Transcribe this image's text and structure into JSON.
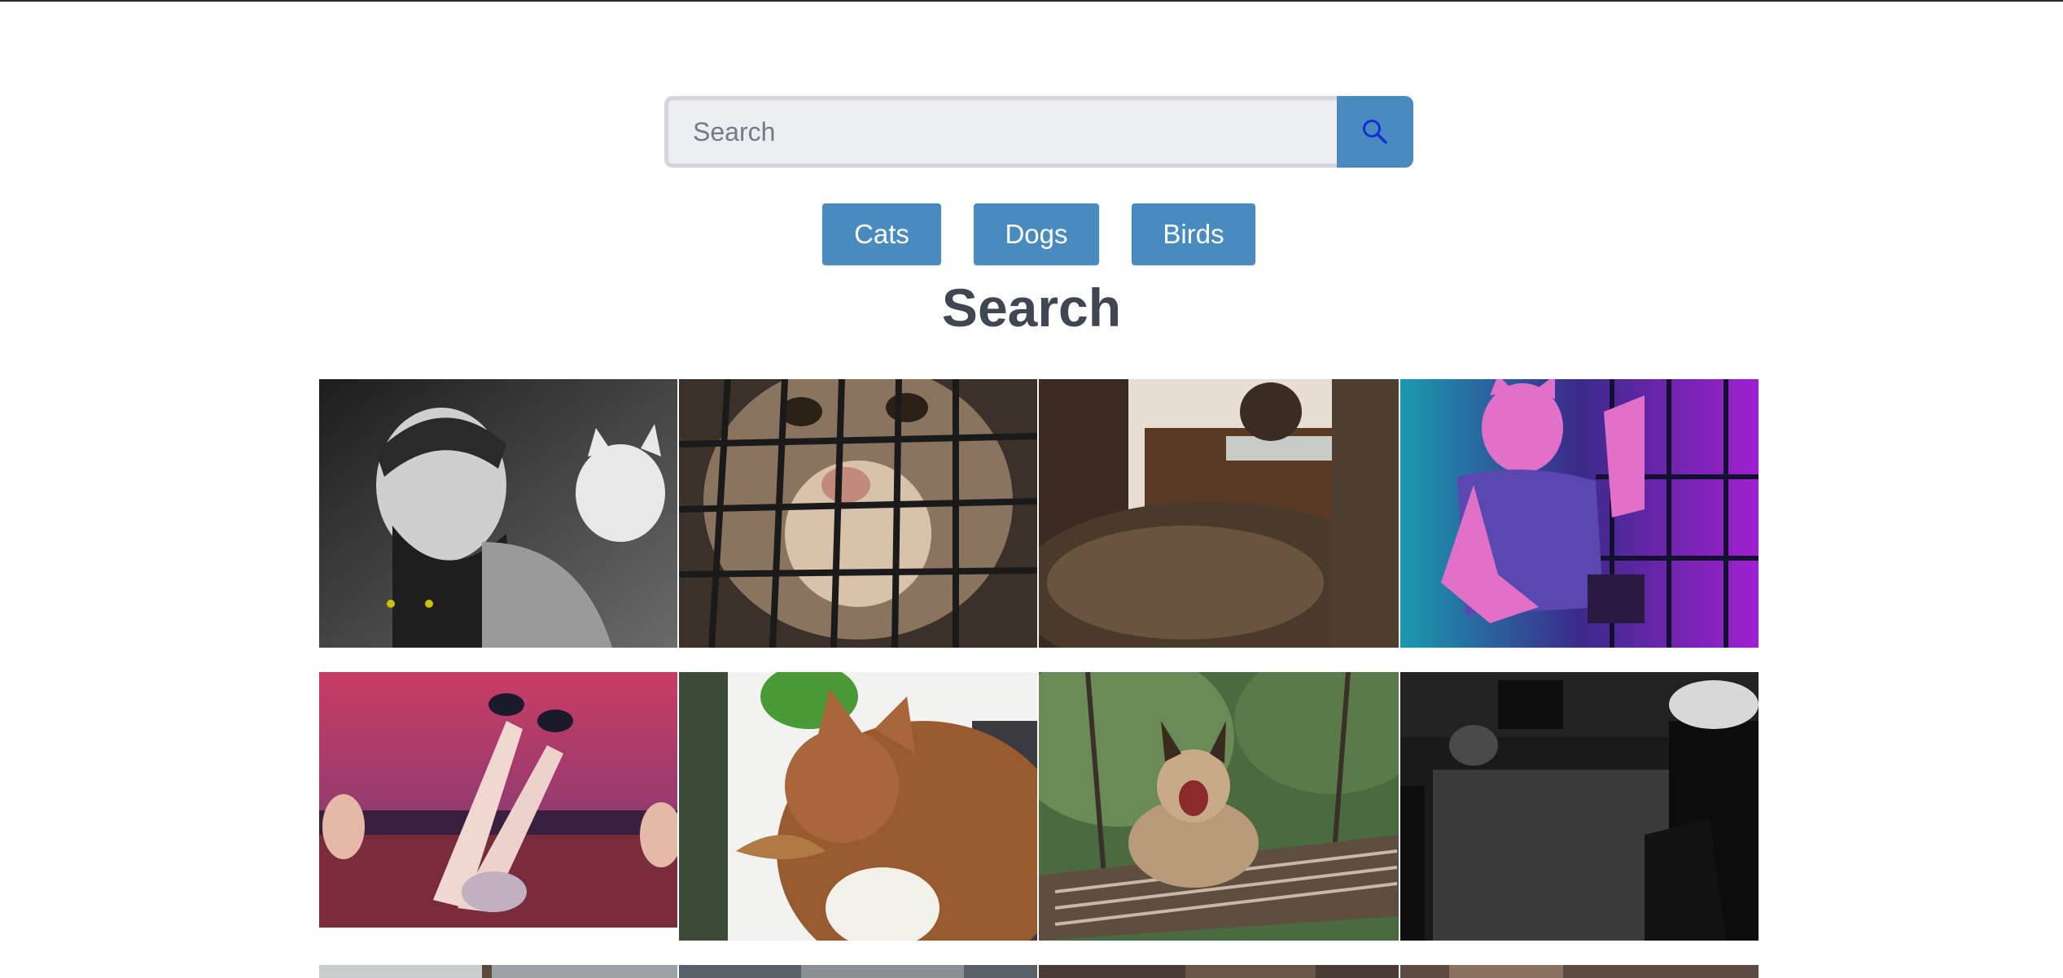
{
  "search": {
    "placeholder": "Search",
    "value": ""
  },
  "categories": [
    {
      "label": "Cats"
    },
    {
      "label": "Dogs"
    },
    {
      "label": "Birds"
    }
  ],
  "page_title": "Search",
  "colors": {
    "accent": "#4a8bbf",
    "search_icon": "#1a2bd8",
    "heading": "#3e4752",
    "input_bg": "#eceef1"
  },
  "gallery": {
    "items": [
      {
        "icon": "photo-man-with-cats"
      },
      {
        "icon": "photo-cat-in-carrier"
      },
      {
        "icon": "photo-fluffy-cat-on-chair"
      },
      {
        "icon": "photo-purple-tiger-character"
      },
      {
        "icon": "photo-pink-neon-art"
      },
      {
        "icon": "photo-orange-cat-window"
      },
      {
        "icon": "photo-lynx-yawning"
      },
      {
        "icon": "photo-dark-interior"
      },
      {
        "icon": "photo-partial-row"
      },
      {
        "icon": "photo-partial-row"
      },
      {
        "icon": "photo-partial-row"
      },
      {
        "icon": "photo-partial-row"
      }
    ]
  }
}
